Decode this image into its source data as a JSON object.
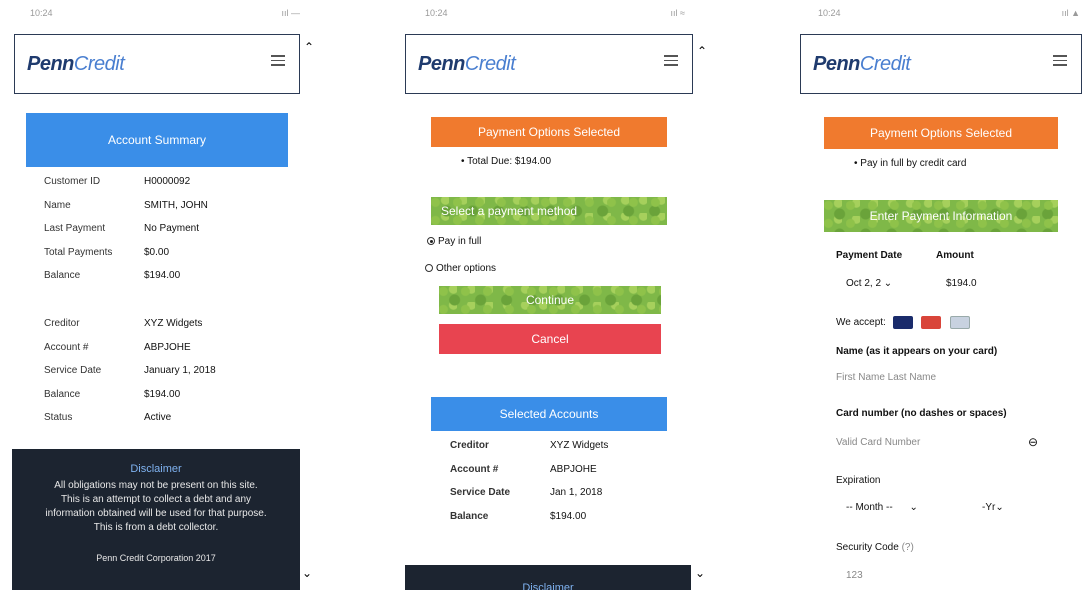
{
  "brand": {
    "penn": "Penn",
    "credit": "Credit"
  },
  "panel1": {
    "status_time": "10:24",
    "status_signal": "ııl —",
    "account_summary_btn": "Account Summary",
    "summary_rows": [
      {
        "k": "Customer ID",
        "v": "H0000092"
      },
      {
        "k": "Name",
        "v": "SMITH, JOHN"
      },
      {
        "k": "Last Payment",
        "v": "No Payment"
      },
      {
        "k": "Total Payments",
        "v": "$0.00"
      },
      {
        "k": "Balance",
        "v": "$194.00"
      }
    ],
    "account_rows": [
      {
        "k": "Creditor",
        "v": "XYZ Widgets"
      },
      {
        "k": "Account #",
        "v": "ABPJOHE"
      },
      {
        "k": "Service Date",
        "v": "January 1, 2018"
      },
      {
        "k": "Balance",
        "v": "$194.00"
      },
      {
        "k": "Status",
        "v": "Active"
      }
    ],
    "disclaimer": {
      "title": "Disclaimer",
      "line1": "All obligations may not be present on this site.",
      "line2": "This is an attempt to collect a debt and any",
      "line3": "information obtained will be used for that purpose.",
      "line4": "This is from a debt collector.",
      "copyright": "Penn Credit Corporation 2017"
    }
  },
  "panel2": {
    "status_time": "10:24",
    "status_signal": "ııl ≈",
    "payment_options_btn": "Payment Options Selected",
    "total_due": "Total Due: $194.00",
    "select_method_btn": "Select a payment method",
    "opt_pay_full": "Pay in full",
    "opt_other": "Other options",
    "continue_btn": "Continue",
    "cancel_btn": "Cancel",
    "selected_accounts_btn": "Selected Accounts",
    "rows": [
      {
        "k": "Creditor",
        "v": "XYZ Widgets"
      },
      {
        "k": "Account #",
        "v": "ABPJOHE"
      },
      {
        "k": "Service Date",
        "v": "Jan 1, 2018"
      },
      {
        "k": "Balance",
        "v": "$194.00"
      }
    ],
    "disclaimer_title": "Disclaimer"
  },
  "panel3": {
    "status_time": "10:24",
    "status_signal": "ııl ▲",
    "payment_options_btn": "Payment Options Selected",
    "pay_in_full": "Pay in full by credit card",
    "enter_payment_btn": "Enter Payment Information",
    "payment_date_label": "Payment Date",
    "amount_label": "Amount",
    "payment_date_value": "Oct 2, 2",
    "amount_value": "$194.0",
    "we_accept": "We accept:",
    "name_label": "Name (as it appears on your card)",
    "name_placeholder": "First Name Last Name",
    "card_label": "Card number (no dashes or spaces)",
    "card_placeholder": "Valid Card Number",
    "expiration_label": "Expiration",
    "month_placeholder": "-- Month --",
    "year_placeholder": "-Yr",
    "security_label": "Security Code",
    "security_help": "(?)",
    "security_placeholder": "123"
  },
  "colors": {
    "blue": "#3a8ee8",
    "orange": "#f07a2e",
    "red": "#e84450",
    "green": "#7fb848",
    "navy": "#1f3b6e",
    "dark": "#1c2430"
  },
  "icons": [
    "hamburger-menu-icon",
    "chevron-up-icon",
    "chevron-down-icon",
    "visa-card-icon",
    "mastercard-icon",
    "amex-card-icon",
    "card-scan-icon"
  ]
}
